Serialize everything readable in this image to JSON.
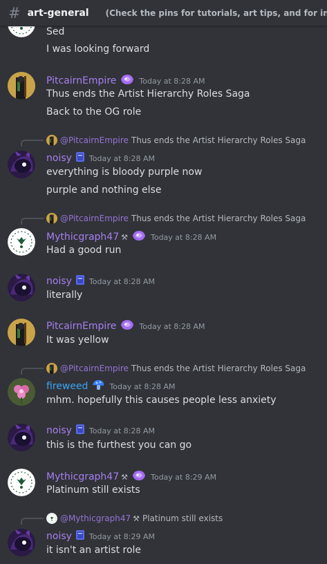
{
  "header": {
    "channel": "art-general",
    "topic": "(Check the pins for tutorials, art tips, and for info on"
  },
  "colors": {
    "background": "#313338",
    "username_purple": "#a87ff0",
    "username_blue": "#3ba5f5",
    "timestamp": "#949ba4",
    "text": "#dbdee1"
  },
  "messages": [
    {
      "lines": [
        "Sed",
        "I was looking forward"
      ]
    },
    {
      "author": "PitcairnEmpire",
      "time": "Today at 8:28 AM",
      "badge": "purple-gem-icon",
      "lines": [
        "Thus ends the Artist Hierarchy Roles Saga",
        "Back to the OG role"
      ]
    },
    {
      "reply": {
        "author": "@PitcairnEmpire",
        "text": "Thus ends the Artist Hierarchy Roles Saga"
      },
      "author": "noisy",
      "time": "Today at 8:28 AM",
      "badge": "purple-book-icon",
      "lines": [
        "everything is bloody purple now",
        "purple and nothing else"
      ]
    },
    {
      "reply": {
        "author": "@PitcairnEmpire",
        "text": "Thus ends the Artist Hierarchy Roles Saga"
      },
      "author": "Mythicgraph47",
      "time": "Today at 8:28 AM",
      "badge": "hammer-pick-icon",
      "lines": [
        "Had a good run"
      ]
    },
    {
      "author": "noisy",
      "time": "Today at 8:28 AM",
      "badge": "purple-book-icon",
      "lines": [
        "literally"
      ]
    },
    {
      "author": "PitcairnEmpire",
      "time": "Today at 8:28 AM",
      "badge": "purple-gem-icon",
      "lines": [
        "It was yellow"
      ]
    },
    {
      "reply": {
        "author": "@PitcairnEmpire",
        "text": "Thus ends the Artist Hierarchy Roles Saga"
      },
      "author": "fireweed",
      "time": "Today at 8:28 AM",
      "badge": "blue-mushroom-icon",
      "lines": [
        "mhm. hopefully this causes people less anxiety"
      ]
    },
    {
      "author": "noisy",
      "time": "Today at 8:28 AM",
      "badge": "purple-book-icon",
      "lines": [
        "this is the furthest you can go"
      ]
    },
    {
      "author": "Mythicgraph47",
      "time": "Today at 8:29 AM",
      "badge": "hammer-pick-icon",
      "lines": [
        "Platinum still exists"
      ]
    },
    {
      "reply": {
        "author": "@Mythicgraph47",
        "text": "Platinum still exists"
      },
      "author": "noisy",
      "time": "Today at 8:29 AM",
      "badge": "purple-book-icon",
      "lines": [
        "it isn't an artist role"
      ]
    }
  ]
}
